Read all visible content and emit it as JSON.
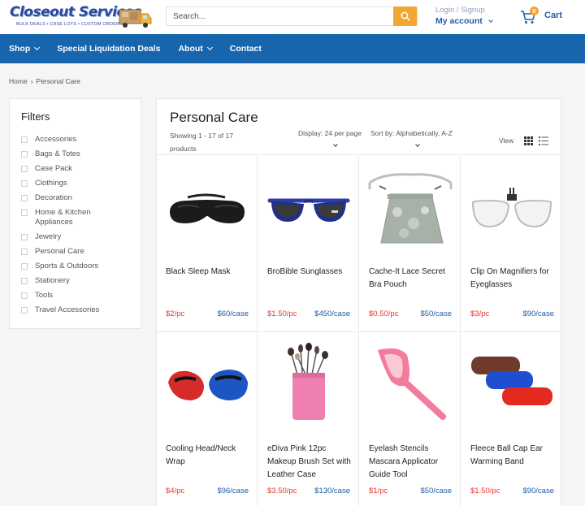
{
  "header": {
    "logo_text": "Closeout Services",
    "logo_tagline": "BULK DEALS  •  CASE LOTS  •  CUSTOM ORDERS",
    "search_placeholder": "Search...",
    "login_label": "Login / Signup",
    "account_label": "My account",
    "cart_count": "0",
    "cart_label": "Cart",
    "accent_color": "#f2a732",
    "brand_color": "#1665ad"
  },
  "nav": {
    "items": [
      {
        "label": "Shop",
        "has_dropdown": true
      },
      {
        "label": "Special Liquidation Deals",
        "has_dropdown": false
      },
      {
        "label": "About",
        "has_dropdown": true
      },
      {
        "label": "Contact",
        "has_dropdown": false
      }
    ]
  },
  "breadcrumb": {
    "home": "Home",
    "current": "Personal Care"
  },
  "filters": {
    "title": "Filters",
    "items": [
      "Accessories",
      "Bags & Totes",
      "Case Pack",
      "Clothings",
      "Decoration",
      "Home & Kitchen Appliances",
      "Jewelry",
      "Personal Care",
      "Sports & Outdoors",
      "Stationery",
      "Tools",
      "Travel Accessories"
    ]
  },
  "main": {
    "title": "Personal Care",
    "showing": "Showing 1 - 17 of 17 products",
    "display": "Display: 24 per page",
    "sort": "Sort by: Alphabetically, A-Z",
    "view_label": "View"
  },
  "products": [
    {
      "name": "Black Sleep Mask",
      "price": "$2/pc",
      "case": "$60/case",
      "icon": "sleep-mask-icon"
    },
    {
      "name": "BroBible Sunglasses",
      "price": "$1.50/pc",
      "case": "$450/case",
      "icon": "sunglasses-icon"
    },
    {
      "name": "Cache-It Lace Secret Bra Pouch",
      "price": "$0.50/pc",
      "case": "$50/case",
      "icon": "pouch-icon"
    },
    {
      "name": "Clip On Magnifiers for Eyeglasses",
      "price": "$3/pc",
      "case": "$90/case",
      "icon": "magnifier-clip-icon"
    },
    {
      "name": "Cooling Head/Neck Wrap",
      "price": "$4/pc",
      "case": "$96/case",
      "icon": "neck-wrap-icon"
    },
    {
      "name": "eDiva Pink 12pc Makeup Brush Set with Leather Case",
      "price": "$3.50/pc",
      "case": "$130/case",
      "icon": "brush-set-icon"
    },
    {
      "name": "Eyelash Stencils Mascara Applicator Guide Tool",
      "price": "$1/pc",
      "case": "$50/case",
      "icon": "eyelash-stencil-icon"
    },
    {
      "name": "Fleece Ball Cap Ear Warming Band",
      "price": "$1.50/pc",
      "case": "$90/case",
      "icon": "ear-band-icon"
    }
  ]
}
